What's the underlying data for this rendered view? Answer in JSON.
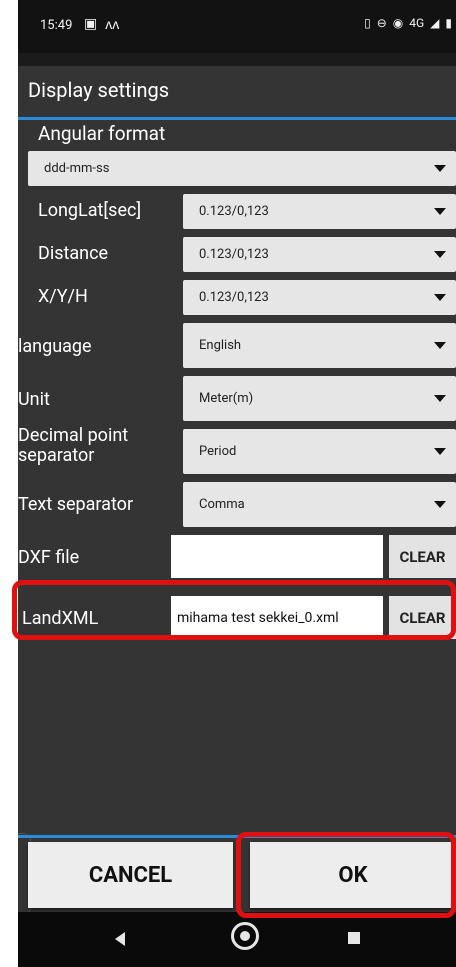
{
  "status_bar": {
    "time": "15:49",
    "signal_text": "4G"
  },
  "dialog": {
    "title": "Display settings",
    "angular_format_label": "Angular format",
    "angular_format_value": "ddd-mm-ss",
    "rows": [
      {
        "label": "LongLat[sec]",
        "value": "0.123/0,123"
      },
      {
        "label": "Distance",
        "value": "0.123/0,123"
      },
      {
        "label": "X/Y/H",
        "value": "0.123/0,123"
      },
      {
        "label": "language",
        "value": "English"
      },
      {
        "label": "Unit",
        "value": "Meter(m)"
      },
      {
        "label": "Decimal point separator",
        "value": "Period"
      },
      {
        "label": "Text separator",
        "value": "Comma"
      }
    ],
    "dxf_label": "DXF file",
    "dxf_value": "",
    "dxf_clear": "CLEAR",
    "landxml_label": "LandXML",
    "landxml_value": "mihama test sekkei_0.xml",
    "landxml_clear": "CLEAR",
    "cancel_label": "CANCEL",
    "ok_label": "OK"
  },
  "colors": {
    "accent": "#2a8cd8",
    "highlight": "#e01010",
    "dialog_bg": "#343434"
  }
}
